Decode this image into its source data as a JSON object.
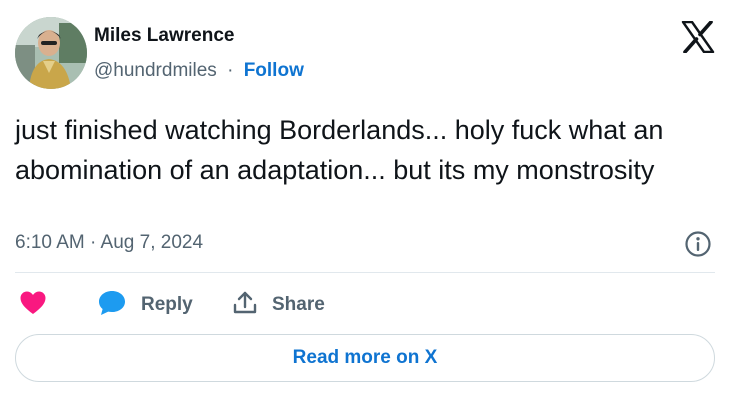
{
  "author": {
    "name": "Miles Lawrence",
    "handle": "@hundrdmiles",
    "separator": "·",
    "follow_label": "Follow"
  },
  "tweet": {
    "text": "just finished watching Borderlands... holy fuck what an abomination of an adaptation... but its my monstrosity",
    "timestamp": "6:10 AM · Aug 7, 2024"
  },
  "actions": {
    "like_icon": "heart-icon",
    "reply_label": "Reply",
    "share_label": "Share"
  },
  "read_more_label": "Read more on X",
  "colors": {
    "accent": "#0f74d1",
    "like": "#f91880",
    "reply_icon": "#1d9bf0",
    "secondary_text": "#536471",
    "primary_text": "#0f1419",
    "border": "#cfd9de"
  }
}
